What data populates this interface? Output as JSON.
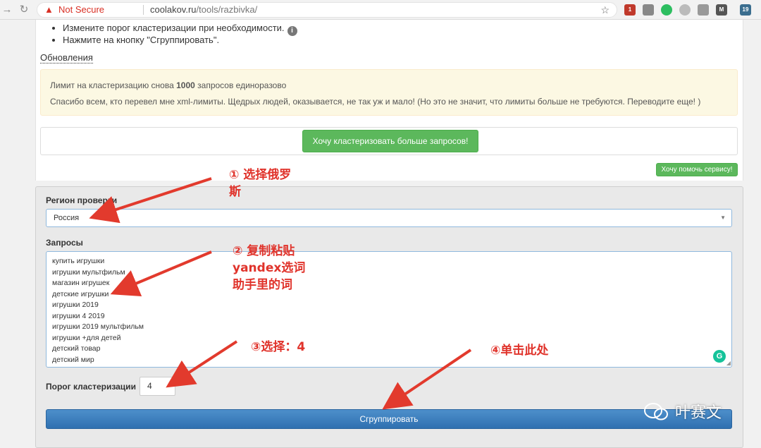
{
  "browser": {
    "not_secure": "Not Secure",
    "url_host": "coolakov.ru",
    "url_path": "/tools/razbivka/",
    "ext_badges": [
      "1",
      "19"
    ]
  },
  "instructions": [
    "Измените порог кластеризации при необходимости.",
    "Нажмите на кнопку \"Сгруппировать\"."
  ],
  "updates_link": "Обновления",
  "alert": {
    "line1_pre": "Лимит на кластеризацию снова ",
    "line1_bold": "1000",
    "line1_post": " запросов единоразово",
    "line2": "Спасибо всем, кто перевел мне xml-лимиты. Щедрых людей, оказывается, не так уж и мало! (Но это не значит, что лимиты больше не требуются. Переводите еще! )"
  },
  "buttons": {
    "more_queries": "Хочу кластеризовать больше запросов!",
    "help_service": "Хочу помочь сервису!",
    "submit": "Сгруппировать"
  },
  "form": {
    "region_label": "Регион проверки",
    "region_value": "Россия",
    "queries_label": "Запросы",
    "queries": [
      "купить игрушки",
      "игрушки мультфильм",
      "магазин игрушек",
      "детские игрушки",
      "игрушки 2019",
      "игрушки 4 2019",
      "игрушки 2019 мультфильм",
      "игрушки +для детей",
      "детский товар",
      "детский мир"
    ],
    "threshold_label": "Порог кластеризации",
    "threshold_value": "4"
  },
  "annotations": {
    "a1_line1": "① 选择俄罗",
    "a1_line2": "斯",
    "a2_line1": "② 复制粘贴",
    "a2_line2": "yandex选词",
    "a2_line3": "助手里的词",
    "a3": "③选择：4",
    "a4": "④单击此处"
  },
  "watermark": "叶赛文",
  "colors": {
    "annotation": "#e0332b",
    "green": "#5cb85c",
    "primary": "#337ab7",
    "alert_bg": "#fcf8e3"
  }
}
